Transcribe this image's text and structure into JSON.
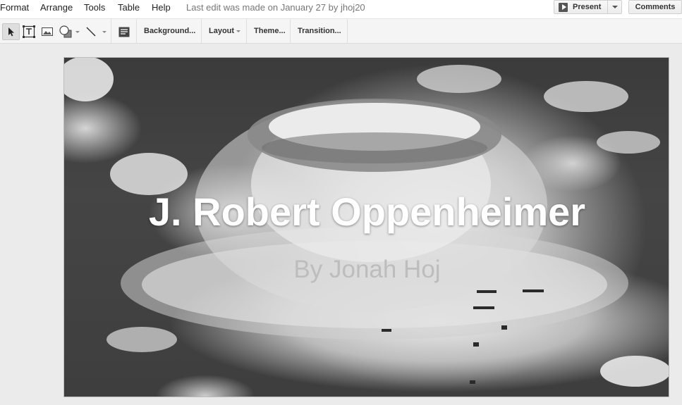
{
  "menubar": {
    "items": [
      "Format",
      "Arrange",
      "Tools",
      "Table",
      "Help"
    ],
    "last_edit": "Last edit was made on January 27 by jhoj20",
    "present_label": "Present",
    "comments_label": "Comments"
  },
  "toolbar": {
    "tools": [
      "select-tool",
      "text-box-tool",
      "image-tool",
      "shape-tool",
      "line-tool",
      "speaker-notes-tool"
    ],
    "background_label": "Background...",
    "layout_label": "Layout",
    "theme_label": "Theme...",
    "transition_label": "Transition..."
  },
  "slide": {
    "title": "J. Robert Oppenheimer",
    "subtitle": "By Jonah Hoj"
  }
}
